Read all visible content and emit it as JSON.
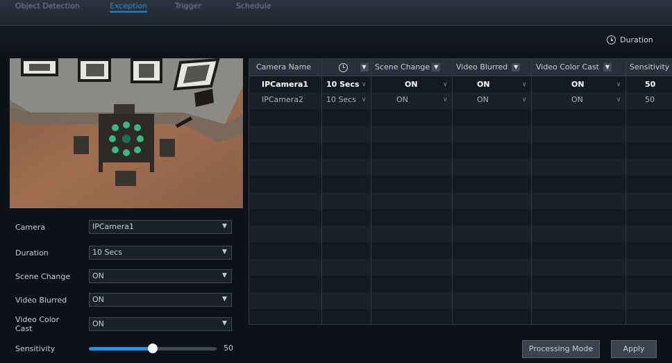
{
  "tabs": [
    "Object Detection",
    "Exception",
    "Trigger",
    "Schedule"
  ],
  "legend": {
    "icon": "clock-icon",
    "label": "Duration"
  },
  "form": {
    "camera": {
      "label": "Camera",
      "value": "IPCamera1"
    },
    "duration": {
      "label": "Duration",
      "value": "10 Secs"
    },
    "scene_change": {
      "label": "Scene Change",
      "value": "ON"
    },
    "video_blurred": {
      "label": "Video Blurred",
      "value": "ON"
    },
    "video_color_cast": {
      "label": "Video Color Cast",
      "value": "ON"
    },
    "sensitivity": {
      "label": "Sensitivity",
      "value": 50,
      "display": "50",
      "max": 100
    }
  },
  "table": {
    "headers": {
      "camera_name": "Camera Name",
      "duration_icon": "clock-icon",
      "scene_change": "Scene Change",
      "video_blurred": "Video Blurred",
      "video_color_cast": "Video Color Cast",
      "sensitivity": "Sensitivity"
    },
    "rows": [
      {
        "camera": "IPCamera1",
        "duration": "10 Secs",
        "scene_change": "ON",
        "video_blurred": "ON",
        "video_color_cast": "ON",
        "sensitivity": "50"
      },
      {
        "camera": "IPCamera2",
        "duration": "10 Secs",
        "scene_change": "ON",
        "video_blurred": "ON",
        "video_color_cast": "ON",
        "sensitivity": "50"
      }
    ]
  },
  "buttons": {
    "processing_mode": "Processing Mode",
    "apply": "Apply"
  },
  "colors": {
    "accent": "#2f8fd8",
    "background": "#0d1218",
    "header": "#27313b"
  }
}
